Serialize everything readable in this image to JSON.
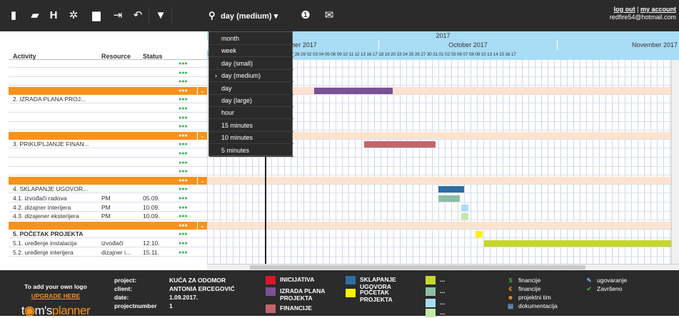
{
  "toolbar": {
    "zoom_label": "day (medium)",
    "icons": [
      "new-icon",
      "open-icon",
      "save-icon",
      "settings-icon",
      "print-icon",
      "export-icon",
      "undo-icon",
      "filter-icon",
      "search-icon",
      "info-icon",
      "mail-icon"
    ]
  },
  "user": {
    "logout": "log out",
    "separator": "|",
    "account": "my account",
    "email": "redfire54@hotmail.com"
  },
  "columns": {
    "activity": "Activity",
    "resource": "Resource",
    "status": "Status"
  },
  "rows": [
    {
      "activity": "",
      "resource": "",
      "status": "",
      "type": "blank"
    },
    {
      "activity": "",
      "resource": "",
      "status": "",
      "type": "blank"
    },
    {
      "activity": "",
      "resource": "",
      "status": "",
      "type": "blank"
    },
    {
      "activity": "",
      "resource": "",
      "status": "",
      "type": "orange"
    },
    {
      "activity": "2. IZRADA PLANA PROJ...",
      "resource": "",
      "status": "",
      "type": "blank"
    },
    {
      "activity": "",
      "resource": "",
      "status": "",
      "type": "blank"
    },
    {
      "activity": "",
      "resource": "",
      "status": "",
      "type": "blank"
    },
    {
      "activity": "",
      "resource": "",
      "status": "",
      "type": "blank"
    },
    {
      "activity": "",
      "resource": "",
      "status": "",
      "type": "orange"
    },
    {
      "activity": "3. PRIKUPLJANJE FINAN...",
      "resource": "",
      "status": "",
      "type": "blank"
    },
    {
      "activity": "",
      "resource": "",
      "status": "",
      "type": "blank"
    },
    {
      "activity": "",
      "resource": "",
      "status": "",
      "type": "blank"
    },
    {
      "activity": "",
      "resource": "",
      "status": "",
      "type": "blank"
    },
    {
      "activity": "",
      "resource": "",
      "status": "",
      "type": "orange"
    },
    {
      "activity": "4. SKLAPANJE UGOVOR...",
      "resource": "",
      "status": "",
      "type": "blank"
    },
    {
      "activity": "4.1. izvođači radova",
      "resource": "PM",
      "status": "05.09.",
      "type": "blank"
    },
    {
      "activity": "4.2. dizajner interijera",
      "resource": "PM",
      "status": "10.09.",
      "type": "blank"
    },
    {
      "activity": "4.3. dizajener eksterijera",
      "resource": "PM",
      "status": "10.09.",
      "type": "blank"
    },
    {
      "activity": "",
      "resource": "",
      "status": "",
      "type": "orange"
    },
    {
      "activity": "5. POČETAK PROJEKTA",
      "resource": "",
      "status": "",
      "type": "bold"
    },
    {
      "activity": "5.1. uređenje instalacija",
      "resource": "izvođači",
      "status": "12.10.",
      "type": "blank"
    },
    {
      "activity": "5.2. uređenje interijera",
      "resource": "dizajner i...",
      "status": "15.11.",
      "type": "blank"
    }
  ],
  "timeline": {
    "year": "2017",
    "months": [
      "September 2017",
      "October 2017",
      "November 2017"
    ],
    "days": "7 08 11 12 13 14 15 18 19 20 21 22 25 26 27 28 29 02 03 04 05 06 09 10 11 12 13 16 17 18 19 20 23 24 25 26 27 30 31 01 02 03 06 07 08 09 10 13 14 15 16 17"
  },
  "zoom_menu": [
    "month",
    "week",
    "day (small)",
    "day (medium)",
    "day",
    "day (large)",
    "hour",
    "15 minutes",
    "10 minutes",
    "5 minutes"
  ],
  "zoom_selected": "day (medium)",
  "project": {
    "project_key": "project:",
    "project": "KUĆA ZA ODOMOR",
    "client_key": "client:",
    "client": "ANTONIA ERCEGOVIĆ",
    "date_key": "date:",
    "date": "1.09.2017.",
    "number_key": "projectnumber",
    "number": "1"
  },
  "logo": {
    "line1": "To add your own logo",
    "line2": "UPGRADE HERE",
    "brand_a": "t",
    "brand_b": "m's",
    "brand_c": "planner"
  },
  "legend_colors": [
    {
      "label": "INICIJATIVA",
      "color": "#d7182a"
    },
    {
      "label": "IZRADA PLANA PROJEKTA",
      "color": "#7a5194"
    },
    {
      "label": "FINANCIJE",
      "color": "#c1666b"
    },
    {
      "label": "SKLAPANJE UGOVORA",
      "color": "#2e6da4"
    },
    {
      "label": "POČETAK PROJEKTA",
      "color": "#fff200"
    },
    {
      "label": "...",
      "color": "#c5d62c"
    },
    {
      "label": "...",
      "color": "#8cbfa6"
    },
    {
      "label": "...",
      "color": "#a9dcf5"
    },
    {
      "label": "...",
      "color": "#c5e8a8"
    }
  ],
  "legend_icons": [
    {
      "icon": "$",
      "label": "financije",
      "color": "#2cb34a"
    },
    {
      "icon": "€",
      "label": "financije",
      "color": "#f7921e"
    },
    {
      "icon": "☻",
      "label": "projektni tim",
      "color": "#f7921e"
    },
    {
      "icon": "▤",
      "label": "dokumentacija",
      "color": "#6fa8dc"
    },
    {
      "icon": "✎",
      "label": "ugovaranje",
      "color": "#6fa8dc"
    },
    {
      "icon": "✔",
      "label": "Završeno",
      "color": "#2cb34a"
    }
  ],
  "bar_colors": {
    "purple": "#7a5194",
    "red": "#c1666b",
    "blue": "#2e6da4",
    "teal": "#8cbfa6",
    "lightblue": "#a9dcf5",
    "lightgreen": "#c5e8a8",
    "yellow": "#fff200",
    "lime": "#c5d62c",
    "orange": "#f7921e"
  }
}
